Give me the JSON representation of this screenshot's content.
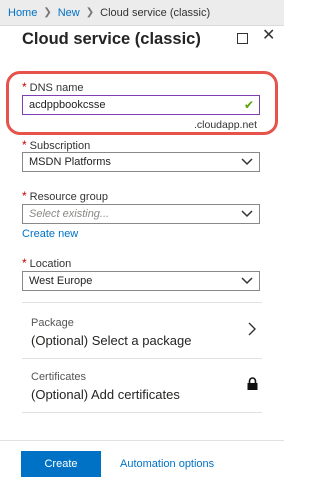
{
  "breadcrumb": {
    "home": "Home",
    "new": "New",
    "current": "Cloud service (classic)"
  },
  "blade": {
    "title": "Cloud service (classic)"
  },
  "dns": {
    "label": "DNS name",
    "value": "acdppbookcsse",
    "suffix": ".cloudapp.net"
  },
  "subscription": {
    "label": "Subscription",
    "value": "MSDN Platforms"
  },
  "resource_group": {
    "label": "Resource group",
    "placeholder": "Select existing...",
    "create_link": "Create new"
  },
  "location": {
    "label": "Location",
    "value": "West Europe"
  },
  "package": {
    "title": "Package",
    "value": "(Optional) Select a package"
  },
  "certificates": {
    "title": "Certificates",
    "value": "(Optional) Add certificates"
  },
  "footer": {
    "create_label": "Create",
    "automation_label": "Automation options"
  },
  "colors": {
    "accent": "#0072c6",
    "highlight": "#e5534b",
    "valid": "#57a300",
    "active_border": "#7f3fb1"
  },
  "icons": [
    "chevron-right-icon",
    "maximize-icon",
    "close-icon",
    "check-icon",
    "chevron-down-icon",
    "lock-icon"
  ]
}
